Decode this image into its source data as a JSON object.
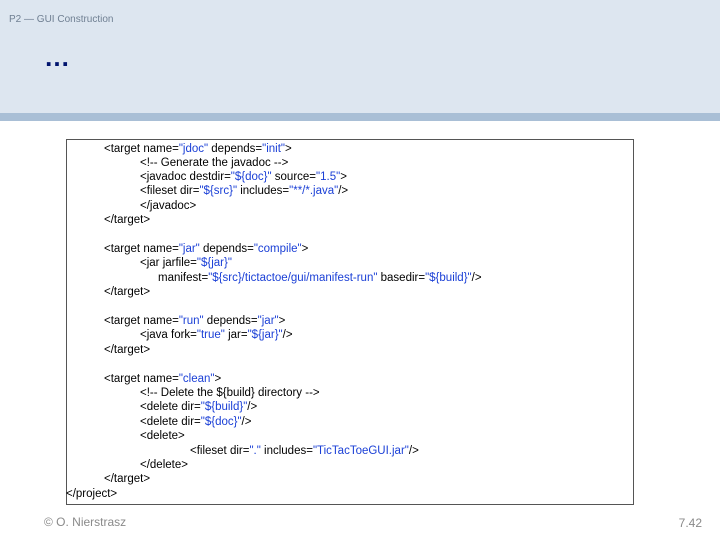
{
  "header": {
    "breadcrumb": "P2 — GUI Construction",
    "title": "…"
  },
  "code": {
    "lines": [
      [
        "<target name=",
        "\"jdoc\"",
        " depends=",
        "\"init\"",
        ">"
      ],
      [
        "<!-- Generate the javadoc -->"
      ],
      [
        "<javadoc destdir=",
        "\"${doc}\"",
        " source=",
        "\"1.5\"",
        ">"
      ],
      [
        "<fileset dir=",
        "\"${src}\"",
        " includes=",
        "\"**/*.java\"",
        "/>"
      ],
      [
        "</javadoc>"
      ],
      [
        "</target>"
      ],
      [
        "<target name=",
        "\"jar\"",
        " depends=",
        "\"compile\"",
        ">"
      ],
      [
        "<jar jarfile=",
        "\"${jar}\""
      ],
      [
        "manifest=",
        "\"${src}/tictactoe/gui/manifest-run\"",
        " basedir=",
        "\"${build}\"",
        "/>"
      ],
      [
        "</target>"
      ],
      [
        "<target name=",
        "\"run\"",
        " depends=",
        "\"jar\"",
        ">"
      ],
      [
        "<java fork=",
        "\"true\"",
        " jar=",
        "\"${jar}\"",
        "/>"
      ],
      [
        "</target>"
      ],
      [
        "<target name=",
        "\"clean\"",
        ">"
      ],
      [
        "<!-- Delete the ${build} directory -->"
      ],
      [
        "<delete dir=",
        "\"${build}\"",
        "/>"
      ],
      [
        "<delete dir=",
        "\"${doc}\"",
        "/>"
      ],
      [
        "<delete>"
      ],
      [
        "<fileset dir=",
        "\".\"",
        " includes=",
        "\"TicTacToeGUI.jar\"",
        "/>"
      ],
      [
        "</delete>"
      ],
      [
        "</target>"
      ],
      [
        "</project>"
      ]
    ]
  },
  "footer": {
    "author": "© O. Nierstrasz",
    "page": "7.42"
  }
}
